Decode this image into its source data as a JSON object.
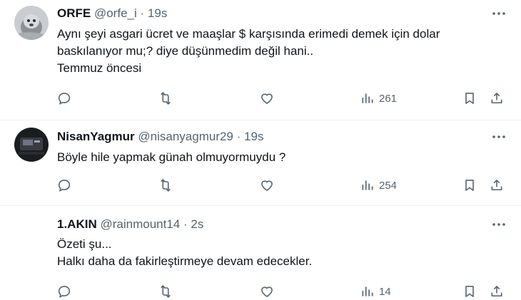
{
  "tweets": [
    {
      "name": "ORFE",
      "handle": "@orfe_i",
      "dot": "·",
      "time": "19s",
      "lines": [
        "Aynı şeyi asgari ücret ve maaşlar $ karşısında erimedi demek için dolar",
        "baskılanıyor mu;? diye düşünmedim değil hani..",
        "Temmuz öncesi"
      ],
      "views": "261"
    },
    {
      "name": "NisanYagmur",
      "handle": "@nisanyagmur29",
      "dot": "·",
      "time": "19s",
      "lines": [
        "Böyle hile yapmak günah olmuyormuydu ?"
      ],
      "views": "254"
    },
    {
      "name": "1.AKIN",
      "handle": "@rainmount14",
      "dot": "·",
      "time": "2s",
      "lines": [
        "Özeti şu...",
        "Halkı daha da fakirleştirmeye devam edecekler."
      ],
      "views": "14"
    }
  ],
  "colors": {
    "text": "#0f1419",
    "secondary": "#536471",
    "divider": "#eff3f4"
  }
}
